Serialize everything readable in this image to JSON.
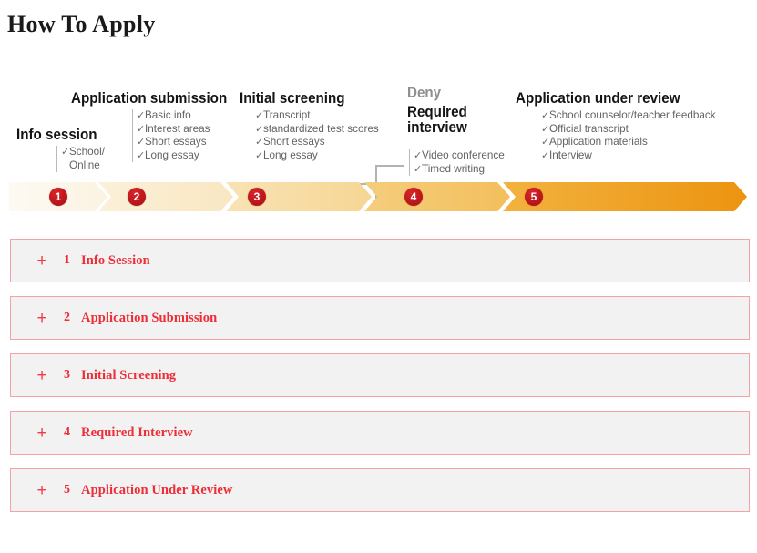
{
  "page": {
    "title": "How To Apply",
    "background": "#ffffff"
  },
  "colors": {
    "accent_red": "#ee2d37",
    "panel_border": "#f5a2a6",
    "panel_background": "#f2f2f2",
    "dot_red": "#c51a1f",
    "heading_black": "#141414",
    "item_gray": "#636363",
    "deny_gray": "#8f8f8f",
    "bracket_gray": "#b3b3b3",
    "arrow_start": "#fdf8ee",
    "arrow_end": "#eb9412"
  },
  "chart_data": {
    "type": "diagram",
    "subtype": "chevron-process-flow",
    "title": "How To Apply",
    "step_count": 5,
    "steps": [
      {
        "number": "1",
        "heading": "Info session",
        "heading_color": "#141414",
        "items": [
          "School/",
          "Online"
        ],
        "checklist": [
          "School/ Online"
        ],
        "arrow_fill": "#fdf8ee"
      },
      {
        "number": "2",
        "heading": "Application submission",
        "heading_color": "#141414",
        "items": [
          "Basic info",
          "Interest areas",
          "Short essays",
          "Long essay"
        ],
        "arrow_fill": "#fbeed4"
      },
      {
        "number": "3",
        "heading": "Initial screening",
        "heading_color": "#141414",
        "items": [
          "Transcript",
          "standardized test scores",
          "Short essays",
          "Long essay"
        ],
        "arrow_fill": "#f7dfae"
      },
      {
        "number": "4",
        "heading": "Required\ninterview",
        "heading_color": "#141414",
        "branch_label": "Deny",
        "branch_label_color": "#8f8f8f",
        "items": [
          "Video conference",
          "Timed writing"
        ],
        "arrow_fill": "#f5c25e"
      },
      {
        "number": "5",
        "heading": "Application under review",
        "heading_color": "#141414",
        "items": [
          "School counselor/teacher feedback",
          "Official transcript",
          "Application materials",
          "Interview"
        ],
        "arrow_fill": "#eb9412"
      }
    ],
    "branch": {
      "from_step": "3",
      "outcomes": [
        "Deny",
        "Required interview"
      ],
      "connector": "bracket"
    },
    "checkmark_glyph": "✓"
  },
  "accordion": {
    "items": [
      {
        "plus": "+",
        "number": "1",
        "label": "Info Session",
        "expanded": false
      },
      {
        "plus": "+",
        "number": "2",
        "label": "Application Submission",
        "expanded": false
      },
      {
        "plus": "+",
        "number": "3",
        "label": "Initial Screening",
        "expanded": false
      },
      {
        "plus": "+",
        "number": "4",
        "label": "Required Interview",
        "expanded": false
      },
      {
        "plus": "+",
        "number": "5",
        "label": "Application Under Review",
        "expanded": false
      }
    ]
  }
}
